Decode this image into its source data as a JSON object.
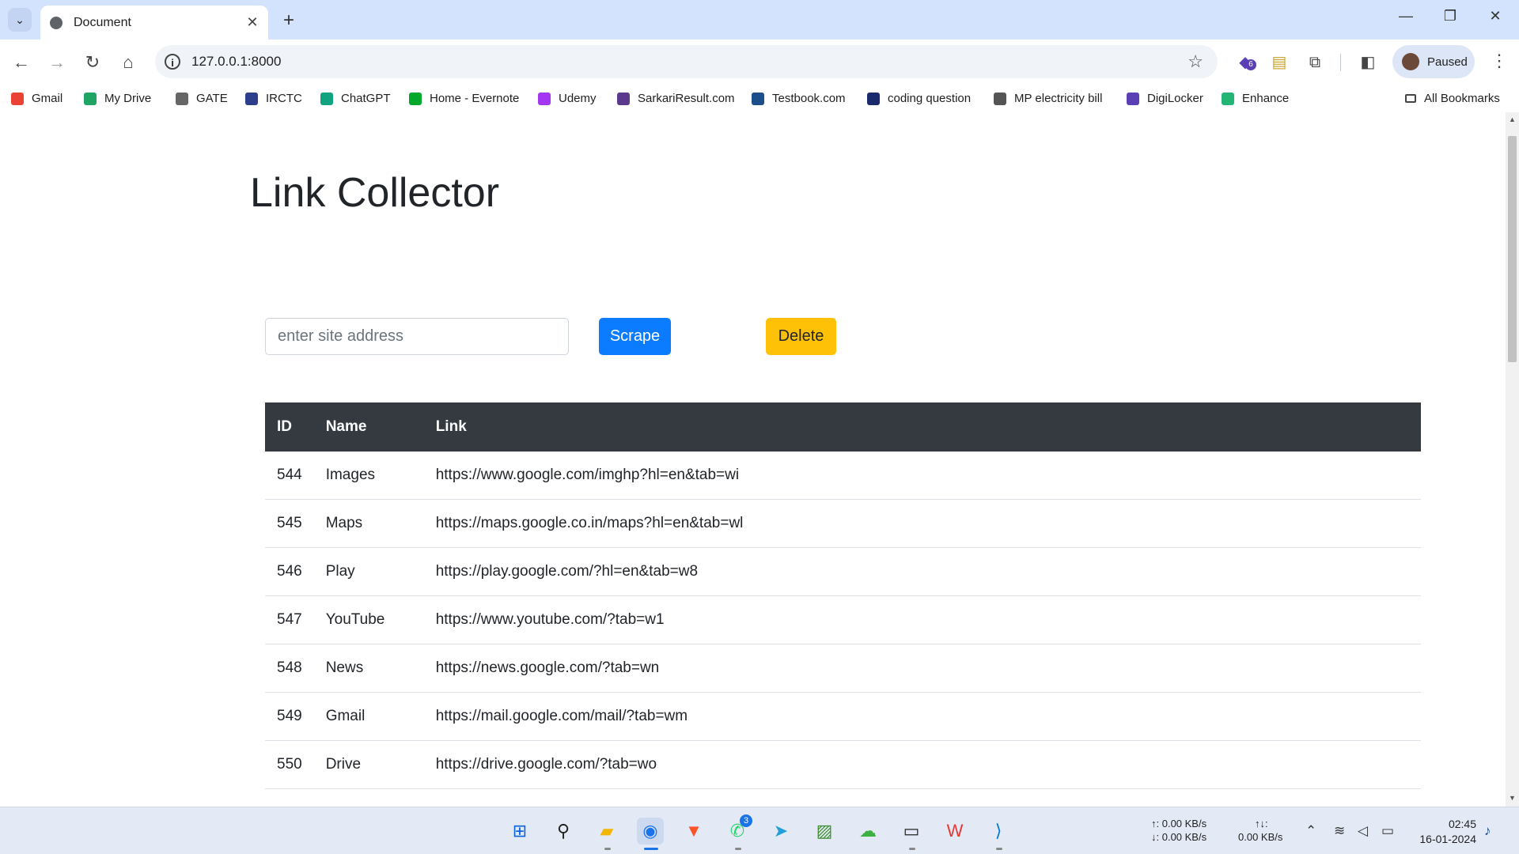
{
  "browser": {
    "tab_title": "Document",
    "tab_close": "✕",
    "new_tab": "+",
    "window_controls": {
      "minimize": "—",
      "maximize": "❐",
      "close": "✕"
    },
    "url": "127.0.0.1:8000",
    "profile_label": "Paused",
    "extension_badge": "6"
  },
  "bookmarks": [
    {
      "label": "Gmail",
      "icon": "gmail-icon",
      "color": "#ea4335"
    },
    {
      "label": "My Drive",
      "icon": "drive-icon",
      "color": "#1fa463"
    },
    {
      "label": "GATE",
      "icon": "gate-icon",
      "color": "#666666"
    },
    {
      "label": "IRCTC",
      "icon": "irctc-icon",
      "color": "#2d3e8b"
    },
    {
      "label": "ChatGPT",
      "icon": "chatgpt-icon",
      "color": "#10a37f"
    },
    {
      "label": "Home - Evernote",
      "icon": "evernote-icon",
      "color": "#00a82d"
    },
    {
      "label": "Udemy",
      "icon": "udemy-icon",
      "color": "#a435f0"
    },
    {
      "label": "SarkariResult.com",
      "icon": "sarkari-icon",
      "color": "#5b3a8e"
    },
    {
      "label": "Testbook.com",
      "icon": "testbook-icon",
      "color": "#1a4f8b"
    },
    {
      "label": "coding question",
      "icon": "coding-icon",
      "color": "#1a2a6c"
    },
    {
      "label": "MP electricity bill",
      "icon": "globe-icon",
      "color": "#555555"
    },
    {
      "label": "DigiLocker",
      "icon": "digilocker-icon",
      "color": "#5b3fb5"
    },
    {
      "label": "Enhance",
      "icon": "enhance-icon",
      "color": "#22b573"
    }
  ],
  "all_bookmarks": "All Bookmarks",
  "page": {
    "heading": "Link Collector",
    "input_placeholder": "enter site address",
    "scrape_label": "Scrape",
    "delete_label": "Delete",
    "table": {
      "headers": [
        "ID",
        "Name",
        "Link"
      ],
      "rows": [
        [
          "544",
          "Images",
          "https://www.google.com/imghp?hl=en&tab=wi"
        ],
        [
          "545",
          "Maps",
          "https://maps.google.co.in/maps?hl=en&tab=wl"
        ],
        [
          "546",
          "Play",
          "https://play.google.com/?hl=en&tab=w8"
        ],
        [
          "547",
          "YouTube",
          "https://www.youtube.com/?tab=w1"
        ],
        [
          "548",
          "News",
          "https://news.google.com/?tab=wn"
        ],
        [
          "549",
          "Gmail",
          "https://mail.google.com/mail/?tab=wm"
        ],
        [
          "550",
          "Drive",
          "https://drive.google.com/?tab=wo"
        ]
      ]
    }
  },
  "taskbar": {
    "whatsapp_badge": "3",
    "net_up": "↑: 0.00 KB/s",
    "net_down": "↓: 0.00 KB/s",
    "net_total_label": "↑↓:",
    "net_total": "0.00 KB/s",
    "time": "02:45",
    "date": "16-01-2024"
  },
  "colors": {
    "primary": "#0b7bff",
    "warning": "#ffc107",
    "table_header": "#343a40"
  }
}
